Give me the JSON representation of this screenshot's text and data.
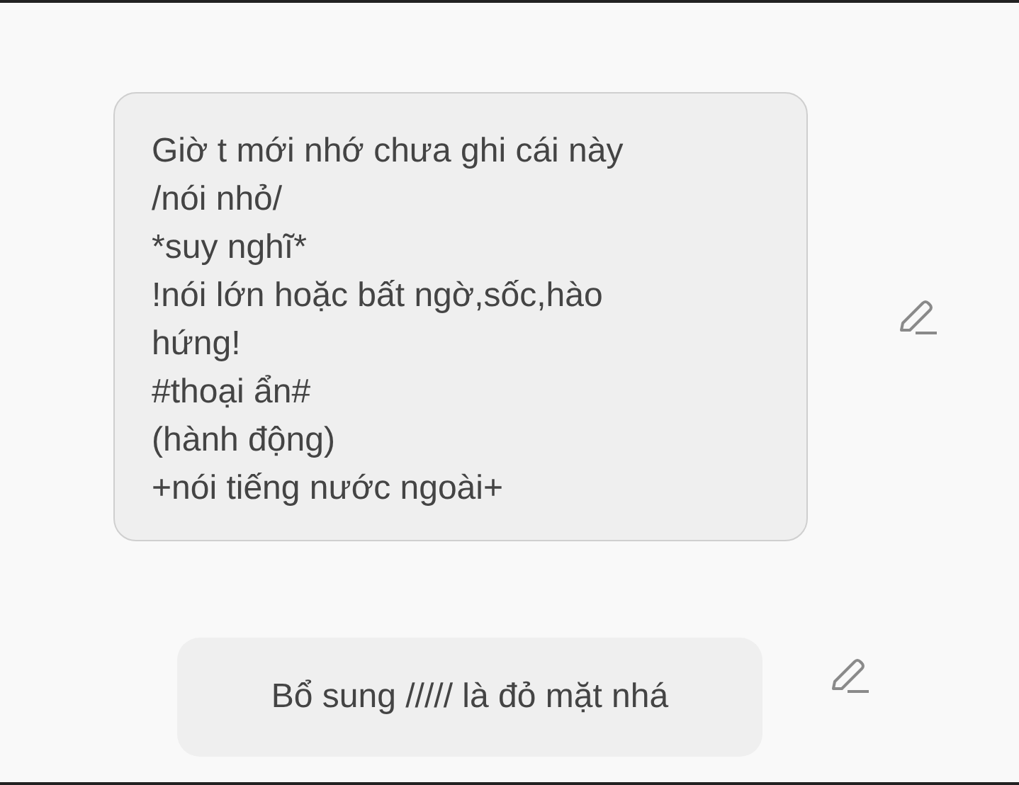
{
  "messages": [
    {
      "text": "Giờ t mới nhớ chưa ghi cái này\n/nói nhỏ/\n*suy nghĩ*\n!nói lớn hoặc bất ngờ,sốc,hào hứng!\n#thoại ẩn#\n(hành động)\n+nói tiếng nước ngoài+",
      "selected": true
    },
    {
      "text": "Bổ sung ///// là đỏ mặt nhá",
      "selected": false
    }
  ]
}
